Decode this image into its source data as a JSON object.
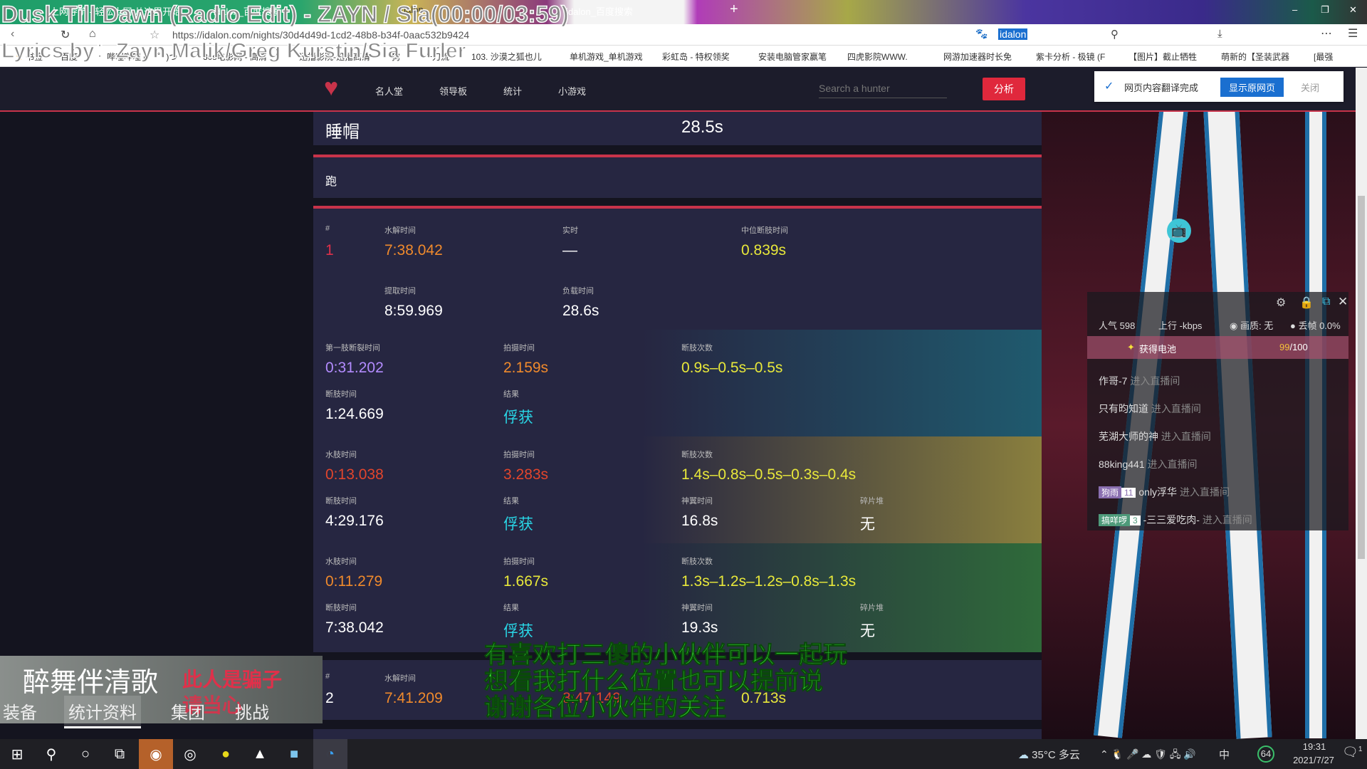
{
  "overlay_lyrics": {
    "song": "Dusk Till Dawn (Radio Edit) - ZAYN / Sia(00:00/03:59)",
    "credits": "Lyrics by：Zayn Malik/Greg Kurstin/Sia Furler"
  },
  "browser": {
    "tabs": [
      "上网导航 - 轻松上网 从这里开始",
      "idalon_百度搜索",
      "idalon",
      "idalon_百度搜索"
    ],
    "url": "https://idalon.com/nights/30d4d49d-1cd2-48b8-b34f-0aac532b9424",
    "search_value": "idalon",
    "bookmarks": [
      "书签",
      "百度",
      "哔哩哔哩 (゜-゜)つ",
      "80s电影网 - 高清",
      "迅播影院-迅播高清",
      "狗",
      "一刀流",
      "103. 沙漠之狐也儿",
      "单机游戏_单机游戏",
      "彩虹岛 - 特权领奖",
      "安装电脑管家赢笔",
      "四虎影院WWW.",
      "网游加速器时长免",
      "紫卡分析 - 极镜 (F",
      "【图片】截止牺牲",
      "萌新的【圣装武器",
      "[最强"
    ]
  },
  "site_nav": {
    "links": [
      "名人堂",
      "领导板",
      "统计",
      "小游戏"
    ],
    "search_placeholder": "Search a hunter",
    "analyze_button": "分析"
  },
  "translate_popup": {
    "message": "网页内容翻译完成",
    "show_original": "显示原网页",
    "close": "关闭"
  },
  "top_card": {
    "title": "睡帽",
    "value": "28.5s"
  },
  "section_header": "跑",
  "runs": [
    {
      "rank_label": "#",
      "rank": "1",
      "labels": {
        "hydro": "水解时间",
        "real": "实时",
        "median": "中位断肢时间",
        "extract": "提取时间",
        "load": "负载时间"
      },
      "hydro": "7:38.042",
      "real": "—",
      "median": "0.839s",
      "extract": "8:59.969",
      "load": "28.6s",
      "phases": [
        {
          "l1": "第一肢断裂时间",
          "v1": "0:31.202",
          "l2": "拍摄时间",
          "v2": "2.159s",
          "l3": "断肢次数",
          "v3": "0.9s–0.5s–0.5s",
          "l4": "断肢时间",
          "v4": "1:24.669",
          "l5": "结果",
          "v5": "俘获"
        },
        {
          "l1": "水肢时间",
          "v1": "0:13.038",
          "l2": "拍摄时间",
          "v2": "3.283s",
          "l3": "断肢次数",
          "v3": "1.4s–0.8s–0.5s–0.3s–0.4s",
          "l4": "断肢时间",
          "v4": "4:29.176",
          "l5": "结果",
          "v5": "俘获",
          "l6": "神翼时间",
          "v6": "16.8s",
          "l7": "碎片堆",
          "v7": "无"
        },
        {
          "l1": "水肢时间",
          "v1": "0:11.279",
          "l2": "拍摄时间",
          "v2": "1.667s",
          "l3": "断肢次数",
          "v3": "1.3s–1.2s–1.2s–0.8s–1.3s",
          "l4": "断肢时间",
          "v4": "7:38.042",
          "l5": "结果",
          "v5": "俘获",
          "l6": "神翼时间",
          "v6": "19.3s",
          "l7": "碎片堆",
          "v7": "无"
        }
      ]
    },
    {
      "rank_label": "#",
      "rank": "2",
      "hydro_label": "水解时间",
      "hydro": "7:41.209",
      "real": "8:47.149",
      "median": "0.713s"
    }
  ],
  "stream_panel": {
    "popularity_label": "人气",
    "popularity": "598",
    "upload_label": "上行",
    "upload": "-kbps",
    "quality": "画质: 无",
    "dropped": "丢帧 0.0%",
    "battery_label": "获得电池",
    "battery_have": "99",
    "battery_total": "/100",
    "chat": [
      {
        "user": "作哥-7",
        "action": "进入直播间"
      },
      {
        "user": "只有昀知道",
        "action": "进入直播间"
      },
      {
        "user": "芜湖大师的神",
        "action": "进入直播间"
      },
      {
        "user": "88king441",
        "action": "进入直播间"
      },
      {
        "badge": "狗雨",
        "level": "11",
        "badge_color": "#8a6fb0",
        "user": "only浮华",
        "action": "进入直播间"
      },
      {
        "badge": "搞咩啰",
        "level": "3",
        "badge_color": "#4e9a7a",
        "user": "-三三爱吃肉-",
        "action": "进入直播间"
      }
    ]
  },
  "game_overlay": {
    "name": "醉舞伴清歌",
    "warning_1": "此人是骗子",
    "warning_2": "请当心",
    "tabs": [
      "装备",
      "统计资料",
      "集团",
      "挑战"
    ],
    "active_tab": "统计资料"
  },
  "subtitle": [
    "有喜欢打三傻的小伙伴可以一起玩",
    "想看我打什么位置也可以提前说",
    "谢谢各位小伙伴的关注"
  ],
  "taskbar": {
    "weather": "35°C 多云",
    "ime": "中",
    "battery_pct": "64",
    "time": "19:31",
    "date": "2021/7/27",
    "notifications": "1"
  },
  "colors": {
    "accent_red": "#c8334a",
    "card_bg": "#262641",
    "hydro_orange": "#f08a2c",
    "median_yellow": "#e8e83a",
    "result_cyan": "#29d6e6"
  }
}
